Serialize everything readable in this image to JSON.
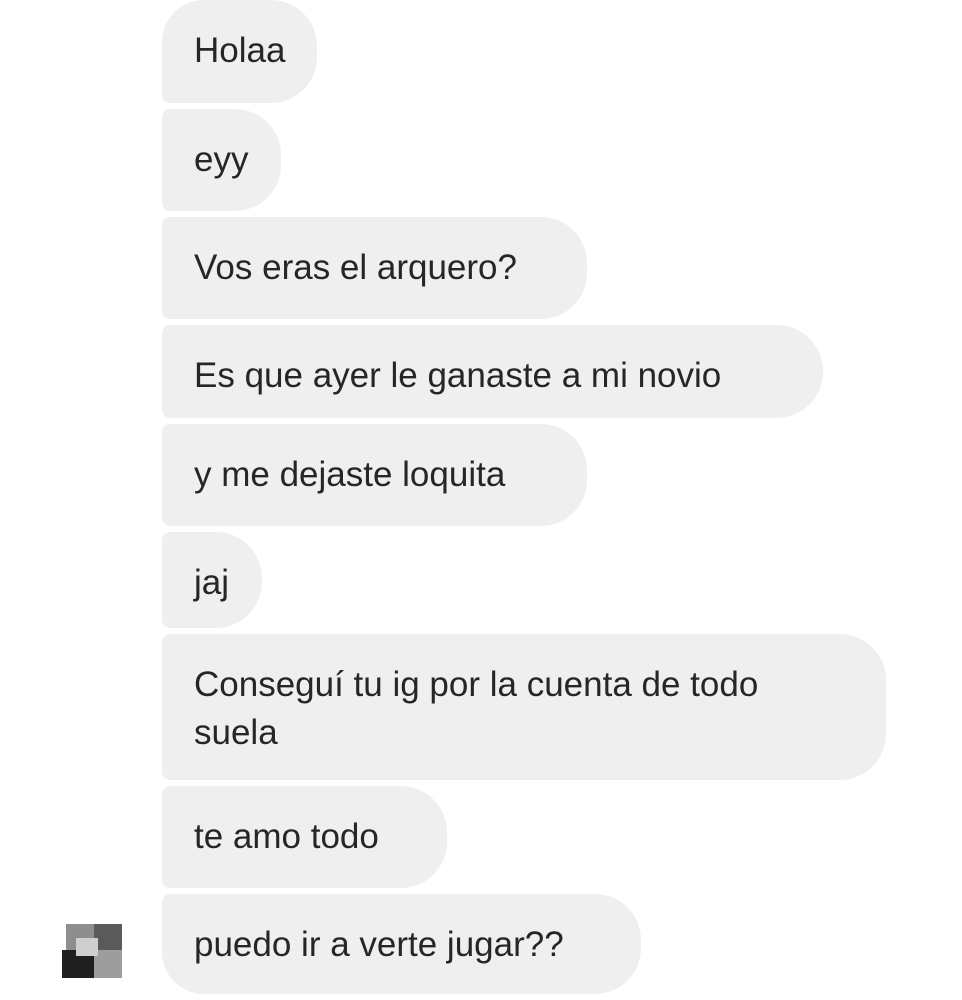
{
  "conversation": {
    "messages": [
      {
        "text": "Holaa"
      },
      {
        "text": "eyy"
      },
      {
        "text": "Vos eras el arquero?"
      },
      {
        "text": "Es que ayer le ganaste a mi novio"
      },
      {
        "text": "y me dejaste loquita"
      },
      {
        "text": "jaj"
      },
      {
        "text": "Conseguí tu ig por la cuenta de todo\nsuela"
      },
      {
        "text": "te amo todo"
      },
      {
        "text": "puedo ir a verte jugar??"
      }
    ]
  },
  "colors": {
    "bubble_background": "#efefef",
    "text": "#262626",
    "page_background": "#ffffff"
  }
}
